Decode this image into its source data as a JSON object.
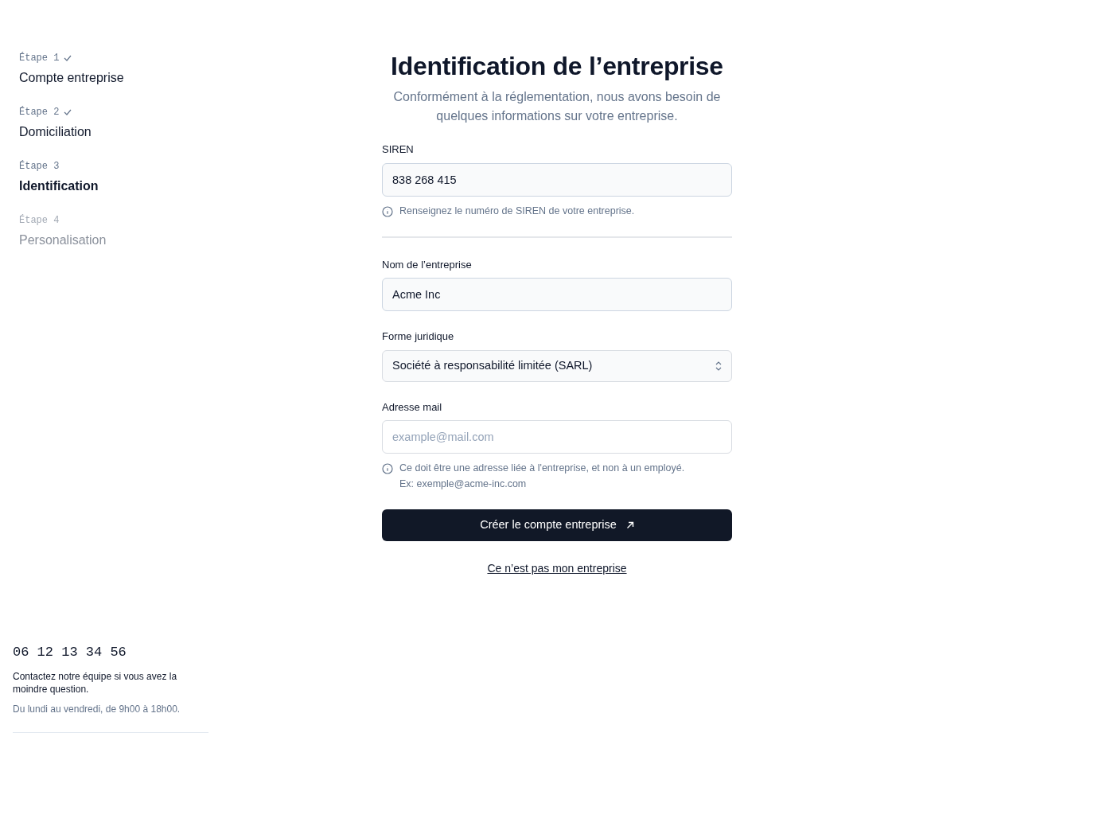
{
  "steps": [
    {
      "label": "Étape 1",
      "title": "Compte entreprise",
      "completed": true,
      "selected": false
    },
    {
      "label": "Étape 2",
      "title": "Domiciliation",
      "completed": true,
      "selected": false
    },
    {
      "label": "Étape 3",
      "title": "Identification",
      "completed": false,
      "selected": true
    },
    {
      "label": "Étape 4",
      "title": "Personalisation",
      "completed": false,
      "selected": false
    }
  ],
  "contact": {
    "phone": "06 12 13 34 56",
    "message": "Contactez notre équipe si vous avez la moindre question.",
    "hours": "Du lundi au vendredi, de 9h00 à 18h00."
  },
  "form": {
    "title": "Identification de l’entreprise",
    "subtitle": "Conformément à la réglementation, nous avons besoin de quelques informations sur votre entreprise.",
    "fields": [
      {
        "kind": "input",
        "label": "SIREN",
        "value": "838 268 415",
        "hint": [
          "Renseignez le numéro de SIREN de votre entreprise."
        ],
        "divider_after": true
      },
      {
        "kind": "input",
        "label": "Nom de l’entreprise",
        "value": "Acme Inc"
      },
      {
        "kind": "select",
        "label": "Forme juridique",
        "value": "Société à responsabilité limitée (SARL)"
      },
      {
        "kind": "input",
        "label": "Adresse mail",
        "placeholder": "example@mail.com",
        "hint": [
          "Ce doit être une adresse liée à l'entreprise, et non à un employé.",
          "Ex: exemple@acme-inc.com"
        ]
      }
    ],
    "submit": "Créer le compte entreprise",
    "link": "Ce n’est pas mon entreprise"
  }
}
